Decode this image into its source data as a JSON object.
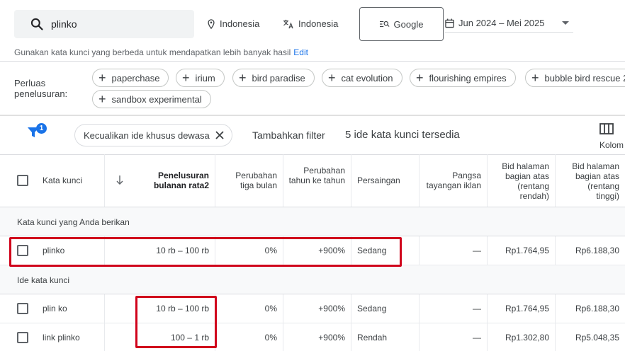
{
  "search": {
    "value": "plinko"
  },
  "location": "Indonesia",
  "language": "Indonesia",
  "network": "Google",
  "date_range": "Jun 2024 – Mei 2025",
  "hint": {
    "text": "Gunakan kata kunci yang berbeda untuk mendapatkan lebih banyak hasil",
    "edit_label": "Edit"
  },
  "broaden": {
    "label": "Perluas penelusuran:",
    "chips": [
      "paperchase",
      "irium",
      "bird paradise",
      "cat evolution",
      "flourishing empires",
      "bubble bird rescue 2",
      "sandbox experimental"
    ]
  },
  "toolbar": {
    "filter_badge": "1",
    "adult_filter": "Kecualikan ide khusus dewasa",
    "add_filter": "Tambahkan filter",
    "count_text": "5 ide kata kunci tersedia",
    "columns_label": "Kolom"
  },
  "table": {
    "headers": {
      "keyword": "Kata kunci",
      "monthly": "Penelusuran bulanan rata2",
      "three_month": "Perubahan tiga bulan",
      "yoy": "Perubahan tahun ke tahun",
      "competition": "Persaingan",
      "ad_share": "Pangsa tayangan iklan",
      "bid_low": "Bid halaman bagian atas (rentang rendah)",
      "bid_high": "Bid halaman bagian atas (rentang tinggi)"
    },
    "section_provided": "Kata kunci yang Anda berikan",
    "section_ideas": "Ide kata kunci",
    "provided_rows": [
      {
        "keyword": "plinko",
        "monthly": "10 rb – 100 rb",
        "three_month": "0%",
        "yoy": "+900%",
        "competition": "Sedang",
        "ad_share": "—",
        "bid_low": "Rp1.764,95",
        "bid_high": "Rp6.188,30"
      }
    ],
    "idea_rows": [
      {
        "keyword": "plin ko",
        "monthly": "10 rb – 100 rb",
        "three_month": "0%",
        "yoy": "+900%",
        "competition": "Sedang",
        "ad_share": "—",
        "bid_low": "Rp1.764,95",
        "bid_high": "Rp6.188,30"
      },
      {
        "keyword": "link plinko",
        "monthly": "100 – 1 rb",
        "three_month": "0%",
        "yoy": "+900%",
        "competition": "Rendah",
        "ad_share": "—",
        "bid_low": "Rp1.302,80",
        "bid_high": "Rp5.048,35"
      }
    ]
  },
  "colors": {
    "accent": "#1a73e8",
    "highlight": "#d0021b",
    "section_bg": "#f8f9fa"
  }
}
